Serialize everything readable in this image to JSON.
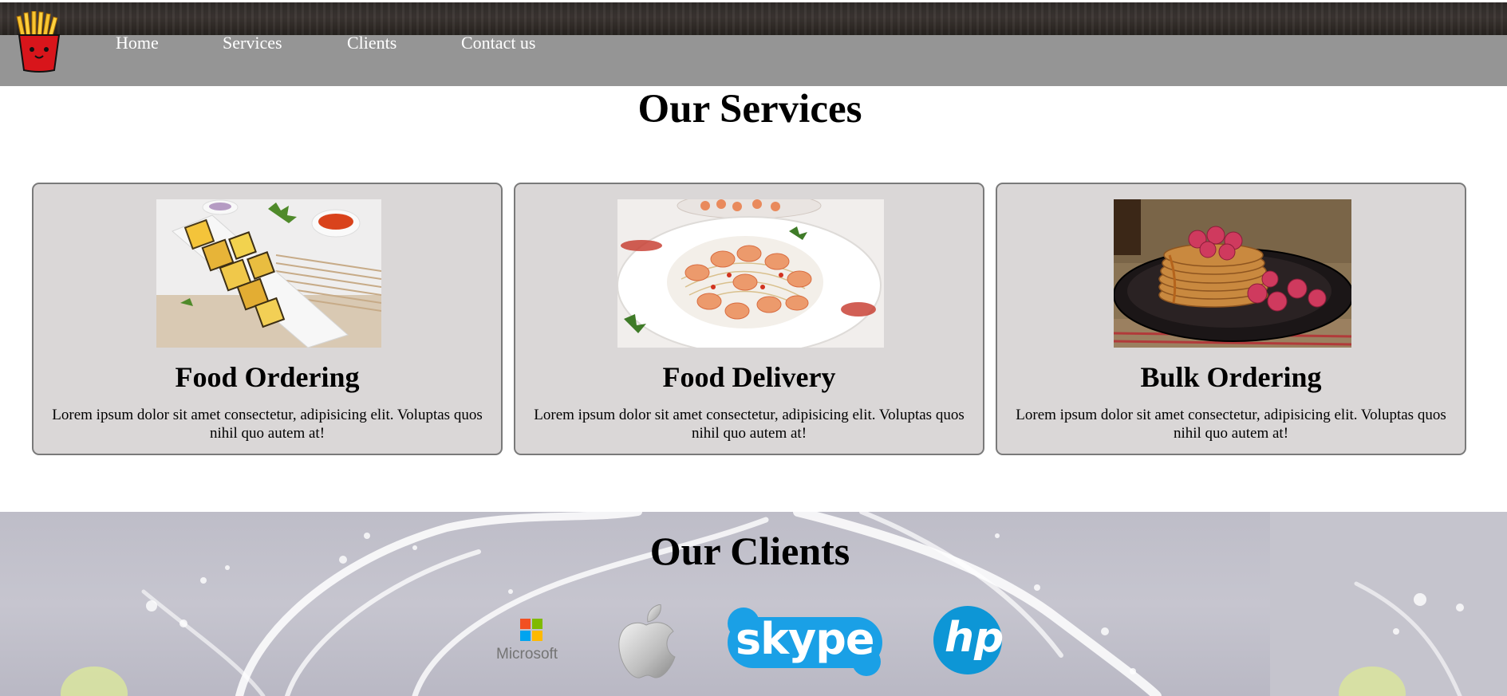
{
  "nav": {
    "items": [
      "Home",
      "Services",
      "Clients",
      "Contact us"
    ]
  },
  "services": {
    "title": "Our Services",
    "cards": [
      {
        "title": "Food Ordering",
        "text": "Lorem ipsum dolor sit amet consectetur, adipisicing elit. Voluptas quos nihil quo autem at!"
      },
      {
        "title": "Food Delivery",
        "text": "Lorem ipsum dolor sit amet consectetur, adipisicing elit. Voluptas quos nihil quo autem at!"
      },
      {
        "title": "Bulk Ordering",
        "text": "Lorem ipsum dolor sit amet consectetur, adipisicing elit. Voluptas quos nihil quo autem at!"
      }
    ]
  },
  "clients": {
    "title": "Our Clients",
    "logos": [
      {
        "icon": "microsoft-logo",
        "label": "Microsoft"
      },
      {
        "icon": "apple-logo"
      },
      {
        "icon": "skype-logo",
        "label": "skype"
      },
      {
        "icon": "hp-logo",
        "label": "hp"
      }
    ]
  },
  "colors": {
    "navbar": "#959595",
    "card_bg": "#dad7d7",
    "card_border": "#7a7a7a",
    "skype_blue": "#1aa0e6",
    "hp_blue": "#0d96d6"
  }
}
